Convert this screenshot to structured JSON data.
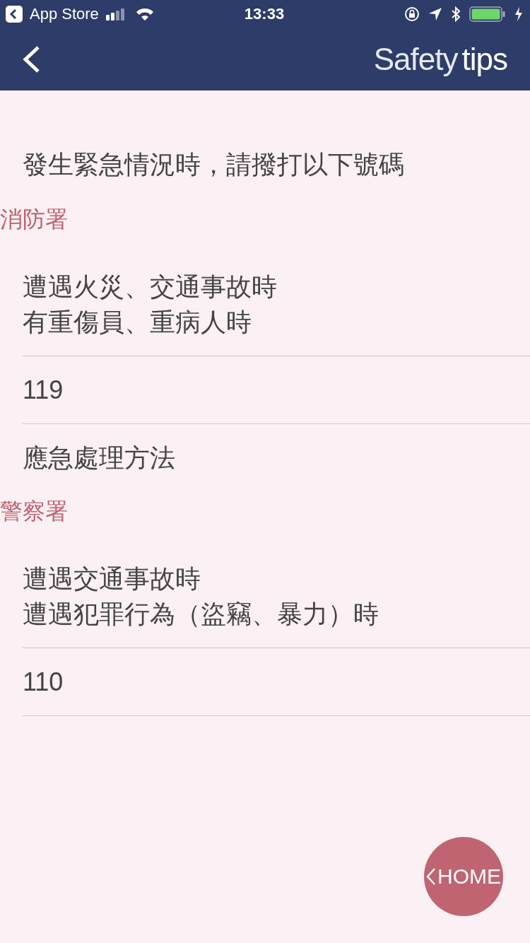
{
  "status_bar": {
    "back_app": "App Store",
    "time": "13:33"
  },
  "header": {
    "title_light": "Safety",
    "title_strong": "tips"
  },
  "intro": "發生緊急情況時，請撥打以下號碼",
  "sections": [
    {
      "heading": "消防署",
      "description_lines": [
        "遭遇火災、交通事故時",
        "有重傷員、重病人時"
      ],
      "number": "119",
      "link": "應急處理方法"
    },
    {
      "heading": "警察署",
      "description_lines": [
        "遭遇交通事故時",
        "遭遇犯罪行為（盜竊、暴力）時"
      ],
      "number": "110"
    }
  ],
  "home_button": {
    "label": "HOME"
  }
}
